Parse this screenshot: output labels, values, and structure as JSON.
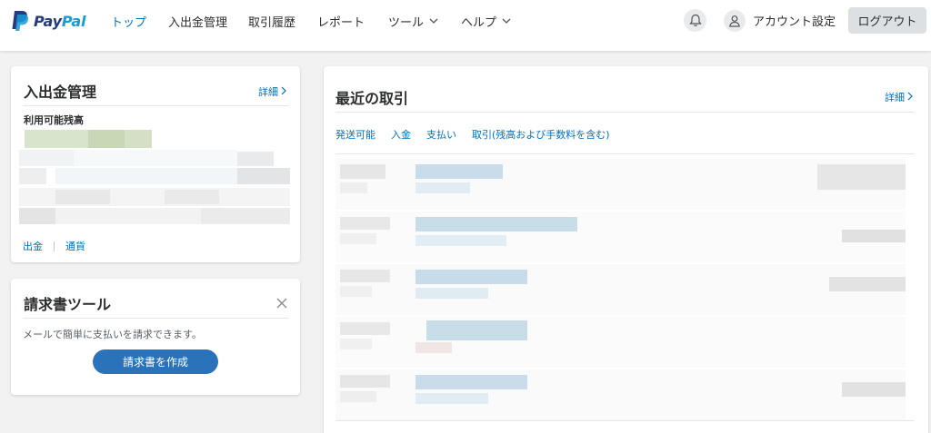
{
  "header": {
    "logo_pay": "Pay",
    "logo_pal": "Pal",
    "nav": {
      "top": "トップ",
      "funds": "入出金管理",
      "history": "取引履歴",
      "reports": "レポート",
      "tools": "ツール",
      "help": "ヘルプ"
    },
    "account_label": "アカウント設定",
    "logout_label": "ログアウト"
  },
  "balance_card": {
    "title": "入出金管理",
    "detail_link": "詳細",
    "available_label": "利用可能残高",
    "withdraw_link": "出金",
    "currency_link": "通貨"
  },
  "invoice_card": {
    "title": "請求書ツール",
    "description": "メールで簡単に支払いを請求できます。",
    "create_button": "請求書を作成"
  },
  "transactions_card": {
    "title": "最近の取引",
    "detail_link": "詳細",
    "tabs": {
      "shipping": "発送可能",
      "incoming": "入金",
      "payments": "支払い",
      "all": "取引(残高および手数料を含む)"
    }
  },
  "colors": {
    "accent": "#0070ba",
    "button": "#2a72b9",
    "background": "#f2f2f2"
  }
}
